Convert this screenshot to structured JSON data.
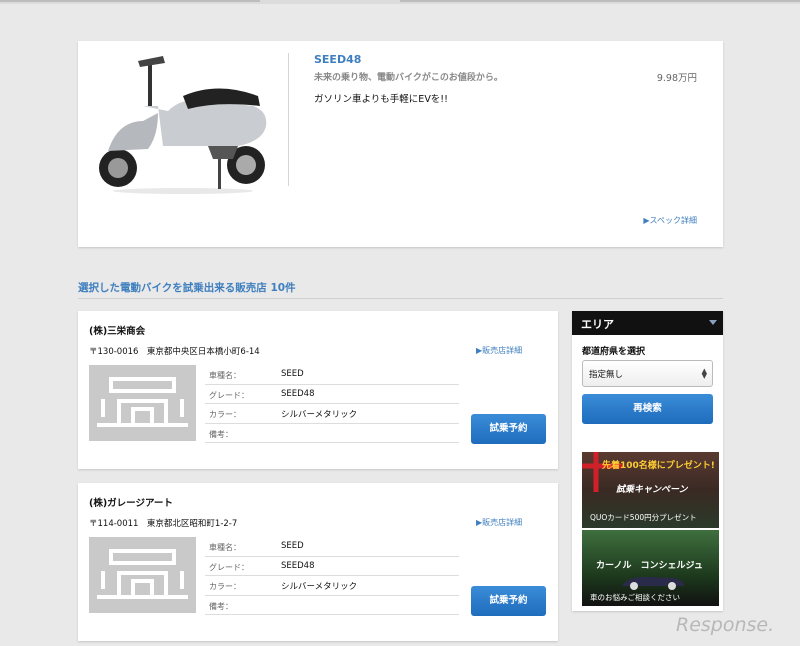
{
  "product": {
    "name": "SEED48",
    "tagline": "未来の乗り物、電動バイクがこのお値段から。",
    "price": "9.98万円",
    "description": "ガソリン車よりも手軽にEVを!!",
    "spec_link": "▶スペック詳細"
  },
  "list_title": "選択した電動バイクを試乗出来る販売店 10件",
  "dealers": [
    {
      "name": "(株)三栄商会",
      "address": "〒130-0016　東京都中央区日本橋小町6-14",
      "detail_link": "▶販売店詳細",
      "rows": [
        {
          "k": "車種名：",
          "v": "SEED"
        },
        {
          "k": "グレード：",
          "v": "SEED48"
        },
        {
          "k": "カラー：",
          "v": "シルバーメタリック"
        },
        {
          "k": "備考：",
          "v": ""
        }
      ],
      "button": "試乗予約"
    },
    {
      "name": "(株)ガレージアート",
      "address": "〒114-0011　東京都北区昭和町1-2-7",
      "detail_link": "▶販売店詳細",
      "rows": [
        {
          "k": "車種名：",
          "v": "SEED"
        },
        {
          "k": "グレード：",
          "v": "SEED48"
        },
        {
          "k": "カラー：",
          "v": "シルバーメタリック"
        },
        {
          "k": "備考：",
          "v": ""
        }
      ],
      "button": "試乗予約"
    }
  ],
  "sidebar": {
    "header": "エリア",
    "label": "都道府県を選択",
    "select_value": "指定無し",
    "search_button": "再検索",
    "banner1": {
      "headline": "先着100名様にプレゼント!",
      "title": "試乗キャンペーン",
      "caption": "QUOカード500円分プレゼント"
    },
    "banner2": {
      "title": "カーノル　コンシェルジュ",
      "caption": "車のお悩みご相談ください"
    }
  },
  "watermark": "Response.",
  "colors": {
    "accent": "#3f7fbf",
    "button": "#1f6cbd",
    "sidebar_header": "#111111"
  }
}
